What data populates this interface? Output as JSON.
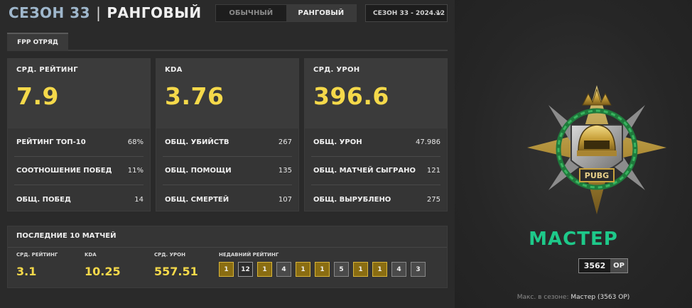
{
  "header": {
    "season_label": "СЕЗОН 33",
    "separator": "|",
    "mode_title": "РАНГОВЫЙ",
    "toggle": {
      "normal": "ОБЫЧНЫЙ",
      "ranked": "РАНГОВЫЙ",
      "active": "ranked"
    },
    "season_select": "СЕЗОН 33 - 2024.12"
  },
  "tab": {
    "label": "FPP ОТРЯД"
  },
  "cards": [
    {
      "label": "СРД. РЕЙТИНГ",
      "value": "7.9",
      "rows": [
        {
          "k": "РЕЙТИНГ ТОП-10",
          "v": "68%"
        },
        {
          "k": "СООТНОШЕНИЕ ПОБЕД",
          "v": "11%"
        },
        {
          "k": "ОБЩ. ПОБЕД",
          "v": "14"
        }
      ]
    },
    {
      "label": "KDA",
      "value": "3.76",
      "rows": [
        {
          "k": "ОБЩ. УБИЙСТВ",
          "v": "267"
        },
        {
          "k": "ОБЩ. ПОМОЩИ",
          "v": "135"
        },
        {
          "k": "ОБЩ. СМЕРТЕЙ",
          "v": "107"
        }
      ]
    },
    {
      "label": "СРД. УРОН",
      "value": "396.6",
      "rows": [
        {
          "k": "ОБЩ. УРОН",
          "v": "47.986"
        },
        {
          "k": "ОБЩ. МАТЧЕЙ СЫГРАНО",
          "v": "121"
        },
        {
          "k": "ОБЩ. ВЫРУБЛЕНО",
          "v": "275"
        }
      ]
    }
  ],
  "recent": {
    "title": "ПОСЛЕДНИЕ 10 МАТЧЕЙ",
    "stats": [
      {
        "label": "СРД. РЕЙТИНГ",
        "value": "3.1"
      },
      {
        "label": "KDA",
        "value": "10.25"
      },
      {
        "label": "СРД. УРОН",
        "value": "557.51"
      }
    ],
    "placements_label": "НЕДАВНИЙ РЕЙТИНГ",
    "placements": [
      "1",
      "12",
      "1",
      "4",
      "1",
      "1",
      "5",
      "1",
      "1",
      "4",
      "3"
    ]
  },
  "rank": {
    "emblem_text": "PUBG",
    "tier": "МАСТЕР",
    "rp_value": "3562",
    "rp_unit": "OP",
    "max_label": "Макс. в сезоне:",
    "max_value": "Мастер (3563 OP)"
  },
  "colors": {
    "accent_yellow": "#f5d94a",
    "tier_green": "#1ec98a",
    "win_gold": "#8a6d12",
    "season_blue": "#9fb7cc"
  }
}
